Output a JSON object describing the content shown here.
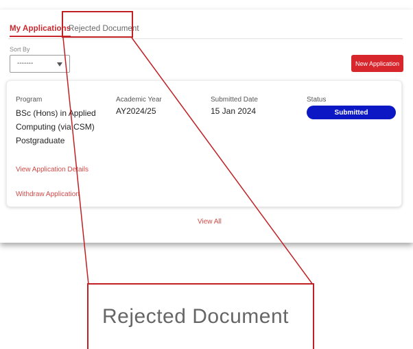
{
  "tabs": {
    "active_label": "My Applications",
    "rejected_label": "Rejected Document"
  },
  "sort": {
    "label": "Sort By",
    "value": "-------"
  },
  "actions": {
    "new_application": "New Application",
    "view_all": "View All"
  },
  "application": {
    "program_label": "Program",
    "program_value": "BSc (Hons) in Applied Computing (via CSM) Postgraduate",
    "year_label": "Academic Year",
    "year_value": "AY2024/25",
    "date_label": "Submitted Date",
    "date_value": "15 Jan 2024",
    "status_label": "Status",
    "status_value": "Submitted",
    "view_details": "View Application Details",
    "withdraw": "Withdraw Application"
  },
  "callout": {
    "zoom_text": "Rejected Document"
  },
  "colors": {
    "accent": "#c8272d",
    "status_blue": "#0b18c4",
    "callout_red": "#c01f24"
  }
}
